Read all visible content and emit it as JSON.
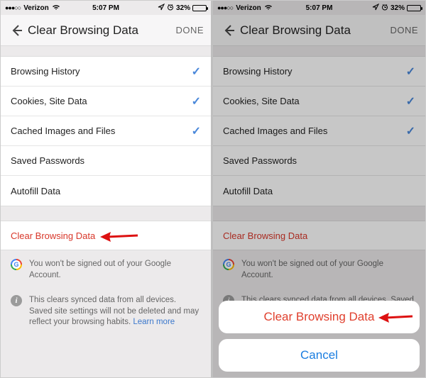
{
  "status": {
    "carrier": "Verizon",
    "time": "5:07 PM",
    "battery_pct": "32%"
  },
  "header": {
    "title": "Clear Browsing Data",
    "done": "DONE"
  },
  "items": [
    {
      "label": "Browsing History",
      "checked": true
    },
    {
      "label": "Cookies, Site Data",
      "checked": true
    },
    {
      "label": "Cached Images and Files",
      "checked": true
    },
    {
      "label": "Saved Passwords",
      "checked": false
    },
    {
      "label": "Autofill Data",
      "checked": false
    }
  ],
  "clear_button": "Clear Browsing Data",
  "note_signed_out": "You won't be signed out of your Google Account.",
  "note_sync": "This clears synced data from all devices. Saved site settings will not be deleted and may reflect your browsing habits. ",
  "learn_more": "Learn more",
  "action_sheet": {
    "destructive": "Clear Browsing Data",
    "cancel": "Cancel"
  }
}
